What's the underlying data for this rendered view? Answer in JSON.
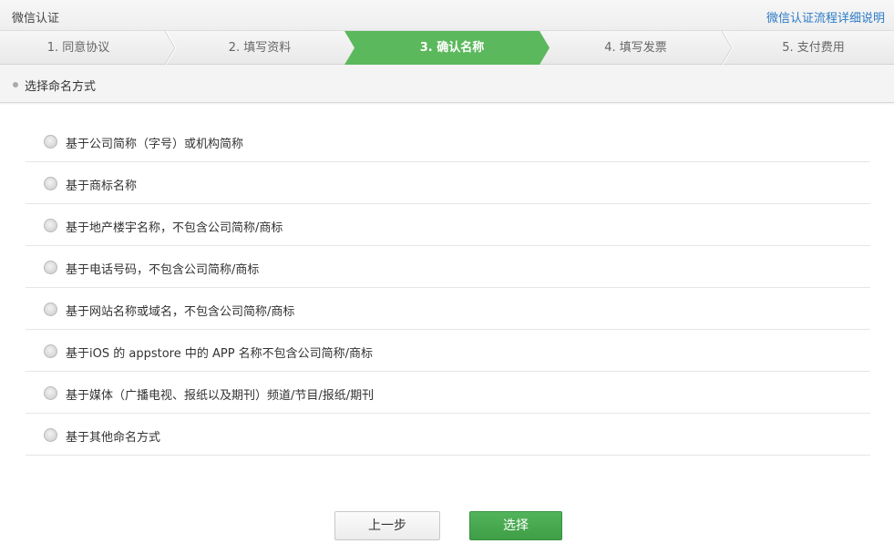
{
  "header": {
    "title": "微信认证",
    "help_link": "微信认证流程详细说明"
  },
  "steps": [
    {
      "label": "1. 同意协议"
    },
    {
      "label": "2. 填写资料"
    },
    {
      "label": "3. 确认名称"
    },
    {
      "label": "4. 填写发票"
    },
    {
      "label": "5. 支付费用"
    }
  ],
  "active_step": 3,
  "section": {
    "title": "选择命名方式"
  },
  "options": [
    {
      "label": "基于公司简称（字号）或机构简称"
    },
    {
      "label": "基于商标名称"
    },
    {
      "label": "基于地产楼宇名称，不包含公司简称/商标"
    },
    {
      "label": "基于电话号码，不包含公司简称/商标"
    },
    {
      "label": "基于网站名称或域名，不包含公司简称/商标"
    },
    {
      "label": "基于iOS 的 appstore 中的 APP 名称不包含公司简称/商标"
    },
    {
      "label": "基于媒体（广播电视、报纸以及期刊）频道/节目/报纸/期刊"
    },
    {
      "label": "基于其他命名方式"
    }
  ],
  "buttons": {
    "prev": "上一步",
    "next": "选择"
  },
  "colors": {
    "active_step": "#5cb85c",
    "link": "#2b7bc7",
    "primary_button": "#46a64e"
  }
}
